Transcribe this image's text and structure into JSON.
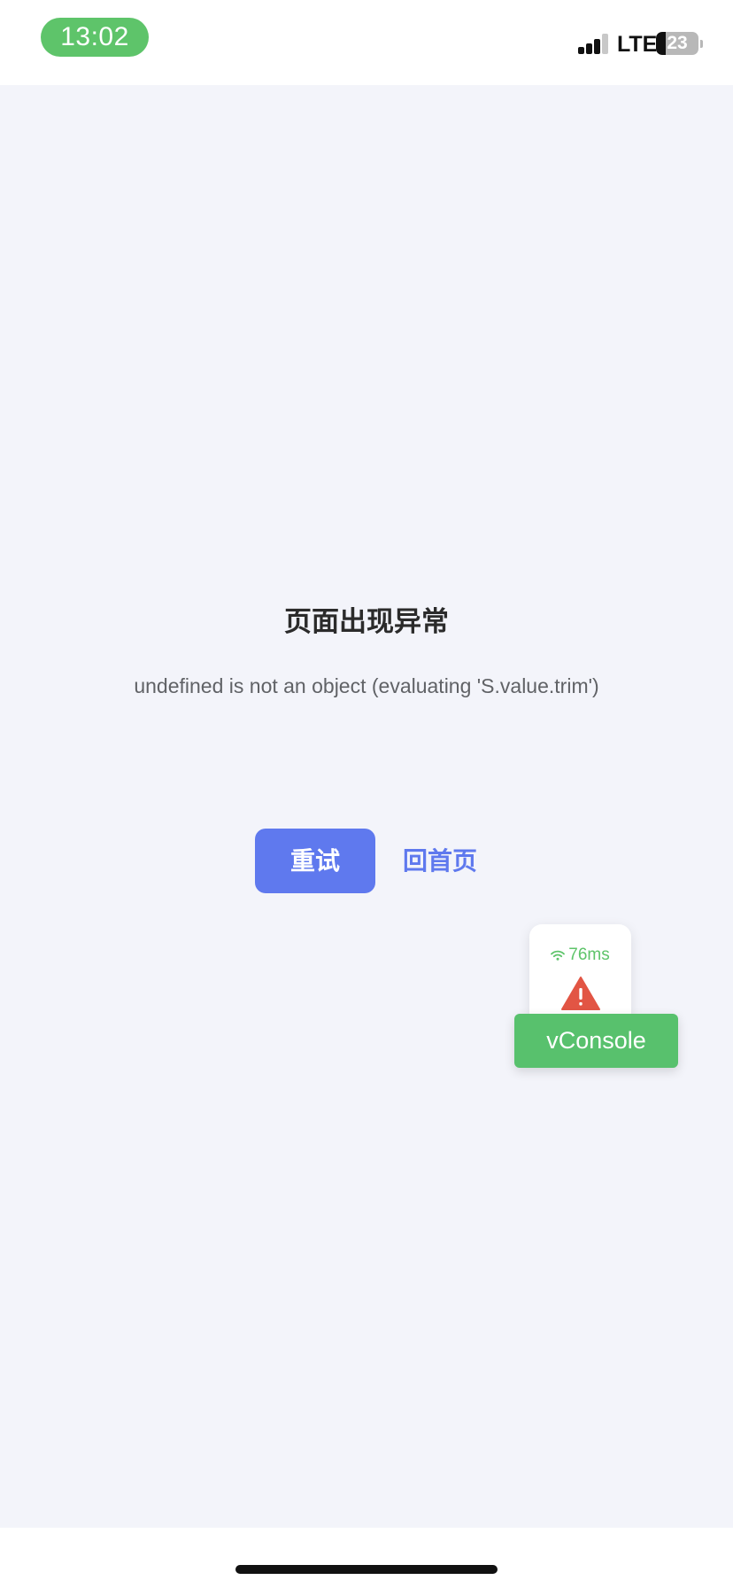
{
  "status_bar": {
    "time": "13:02",
    "network": "LTE",
    "battery_level": "23",
    "battery_fraction": 0.23,
    "signal_bars_active": 3,
    "signal_bars_total": 4
  },
  "error_page": {
    "title": "页面出现异常",
    "message": "undefined is not an object (evaluating 'S.value.trim')",
    "retry_label": "重试",
    "home_label": "回首页"
  },
  "vconsole": {
    "latency": "76ms",
    "button_label": "vConsole",
    "status_icon": "warning-icon"
  },
  "colors": {
    "accent": "#5f79ee",
    "status_green": "#5ec46a",
    "vconsole_green": "#58c16d",
    "warning_red": "#e25544",
    "page_background": "#f3f4fa"
  }
}
